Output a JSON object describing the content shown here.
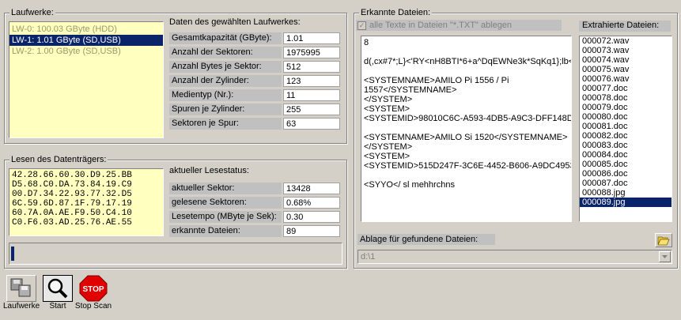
{
  "drives_group": {
    "title": "Laufwerke:",
    "items": [
      {
        "label": "LW-0:    100.03  GByte    (HDD)",
        "selected": false
      },
      {
        "label": "LW-1:    1.01  GByte    (SD,USB)",
        "selected": true
      },
      {
        "label": "LW-2:    1.00  GByte    (SD,USB)",
        "selected": false
      }
    ]
  },
  "drive_details": {
    "title": "Daten des gewählten Laufwerkes:",
    "rows": [
      {
        "label": "Gesamtkapazität (GByte):",
        "value": "1.01"
      },
      {
        "label": "Anzahl der Sektoren:",
        "value": "1975995"
      },
      {
        "label": "Anzahl Bytes je Sektor:",
        "value": "512"
      },
      {
        "label": "Anzahl der Zylinder:",
        "value": "123"
      },
      {
        "label": "Medientyp (Nr.):",
        "value": "11"
      },
      {
        "label": "Spuren je Zylinder:",
        "value": "255"
      },
      {
        "label": "Sektoren je Spur:",
        "value": "63"
      }
    ]
  },
  "read_group": {
    "title": "Lesen des Datenträgers:",
    "hex_lines": [
      "42.28.66.60.30.D9.25.BB",
      "D5.68.C0.DA.73.84.19.C9",
      "00.D7.34.22.93.77.32.D5",
      "6C.59.6D.87.1F.79.17.19",
      "60.7A.0A.AE.F9.50.C4.10",
      "C0.F6.03.AD.25.76.AE.55"
    ],
    "status_title": "aktueller Lesestatus:",
    "rows": [
      {
        "label": "aktueller Sektor:",
        "value": "13428"
      },
      {
        "label": "gelesene Sektoren:",
        "value": "0.68%"
      },
      {
        "label": "Lesetempo (MByte je Sek):",
        "value": "0.30"
      },
      {
        "label": "erkannte Dateien:",
        "value": "89"
      }
    ],
    "progress": 0.0
  },
  "found_group": {
    "title": "Erkannte Dateien:",
    "checkbox_label": "alle Texte in Dateien \"*.TXT\" ablegen",
    "checkbox_checked": true,
    "preview_lines": [
      "8",
      "",
      "d(,cx#7*;L}<'RY<nH8BTI*6+a^DqEWNe3k*SqKq1};lb<V",
      "",
      "<SYSTEMNAME>AMILO Pi 1556 / Pi",
      "1557</SYSTEMNAME>",
      "</SYSTEM>",
      "<SYSTEM>",
      "<SYSTEMID>98010C6C-A593-4DB5-A9C3-DFF148D815",
      "",
      "<SYSTEMNAME>AMILO Si 1520</SYSTEMNAME>",
      "</SYSTEM>",
      "<SYSTEM>",
      "<SYSTEMID>515D247F-3C6E-4452-B606-A9DC4953A4",
      "",
      "<SYYO</ sl mehhrchns"
    ],
    "extracted_title": "Extrahierte Dateien:",
    "files": [
      "000072.wav",
      "000073.wav",
      "000074.wav",
      "000075.wav",
      "000076.wav",
      "000077.doc",
      "000078.doc",
      "000079.doc",
      "000080.doc",
      "000081.doc",
      "000082.doc",
      "000083.doc",
      "000084.doc",
      "000085.doc",
      "000086.doc",
      "000087.doc",
      "000088.jpg",
      "000089.jpg"
    ],
    "selected_file": 17,
    "storage_label": "Ablage für gefundene Dateien:",
    "storage_path": "d:\\1"
  },
  "toolbar": {
    "drives_label": "Laufwerke",
    "start_label": "Start",
    "stop_label": "Stop Scan",
    "stop_icon_text": "STOP"
  }
}
